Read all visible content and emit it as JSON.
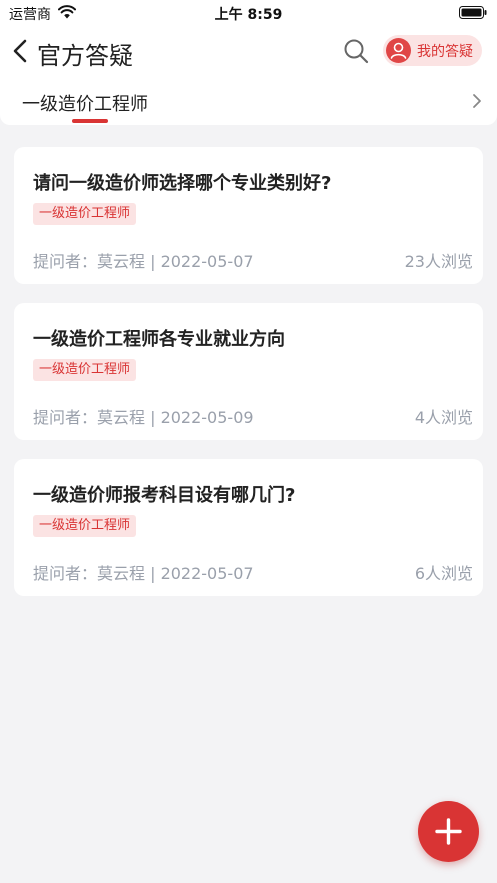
{
  "status_bar": {
    "carrier": "运营商",
    "time": "上午 8:59"
  },
  "nav": {
    "title": "官方答疑",
    "my_qa_label": "我的答疑"
  },
  "tabs": {
    "active_label": "一级造价工程师"
  },
  "questions": [
    {
      "title": "请问一级造价师选择哪个专业类别好?",
      "tag": "一级造价工程师",
      "meta": "提问者：莫云程 | 2022-05-07",
      "views": "23人浏览"
    },
    {
      "title": "一级造价工程师各专业就业方向",
      "tag": "一级造价工程师",
      "meta": "提问者：莫云程 | 2022-05-09",
      "views": "4人浏览"
    },
    {
      "title": "一级造价师报考科目设有哪几门?",
      "tag": "一级造价工程师",
      "meta": "提问者：莫云程 | 2022-05-07",
      "views": "6人浏览"
    }
  ],
  "colors": {
    "accent": "#d93434",
    "tag_bg": "#fbe3e3",
    "page_bg": "#f3f3f5",
    "muted_text": "#9aa0ab"
  },
  "icons": [
    "wifi-icon",
    "battery-icon",
    "back-icon",
    "search-icon",
    "user-icon",
    "chevron-right-icon",
    "plus-icon"
  ]
}
